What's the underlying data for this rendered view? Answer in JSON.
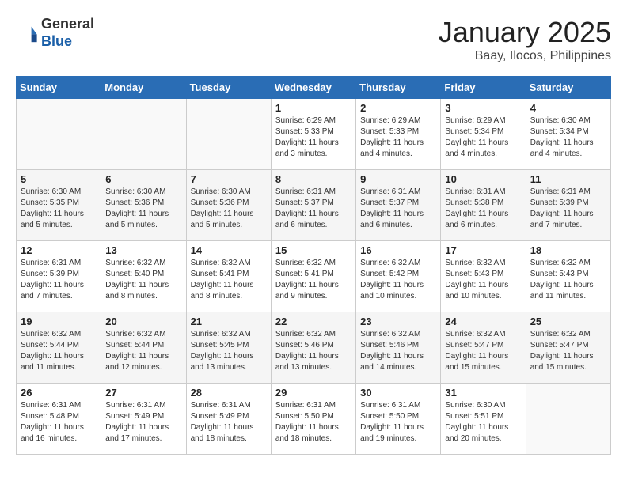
{
  "header": {
    "logo_line1": "General",
    "logo_line2": "Blue",
    "title": "January 2025",
    "subtitle": "Baay, Ilocos, Philippines"
  },
  "weekdays": [
    "Sunday",
    "Monday",
    "Tuesday",
    "Wednesday",
    "Thursday",
    "Friday",
    "Saturday"
  ],
  "weeks": [
    [
      {
        "day": "",
        "sunrise": "",
        "sunset": "",
        "daylight": ""
      },
      {
        "day": "",
        "sunrise": "",
        "sunset": "",
        "daylight": ""
      },
      {
        "day": "",
        "sunrise": "",
        "sunset": "",
        "daylight": ""
      },
      {
        "day": "1",
        "sunrise": "Sunrise: 6:29 AM",
        "sunset": "Sunset: 5:33 PM",
        "daylight": "Daylight: 11 hours and 3 minutes."
      },
      {
        "day": "2",
        "sunrise": "Sunrise: 6:29 AM",
        "sunset": "Sunset: 5:33 PM",
        "daylight": "Daylight: 11 hours and 4 minutes."
      },
      {
        "day": "3",
        "sunrise": "Sunrise: 6:29 AM",
        "sunset": "Sunset: 5:34 PM",
        "daylight": "Daylight: 11 hours and 4 minutes."
      },
      {
        "day": "4",
        "sunrise": "Sunrise: 6:30 AM",
        "sunset": "Sunset: 5:34 PM",
        "daylight": "Daylight: 11 hours and 4 minutes."
      }
    ],
    [
      {
        "day": "5",
        "sunrise": "Sunrise: 6:30 AM",
        "sunset": "Sunset: 5:35 PM",
        "daylight": "Daylight: 11 hours and 5 minutes."
      },
      {
        "day": "6",
        "sunrise": "Sunrise: 6:30 AM",
        "sunset": "Sunset: 5:36 PM",
        "daylight": "Daylight: 11 hours and 5 minutes."
      },
      {
        "day": "7",
        "sunrise": "Sunrise: 6:30 AM",
        "sunset": "Sunset: 5:36 PM",
        "daylight": "Daylight: 11 hours and 5 minutes."
      },
      {
        "day": "8",
        "sunrise": "Sunrise: 6:31 AM",
        "sunset": "Sunset: 5:37 PM",
        "daylight": "Daylight: 11 hours and 6 minutes."
      },
      {
        "day": "9",
        "sunrise": "Sunrise: 6:31 AM",
        "sunset": "Sunset: 5:37 PM",
        "daylight": "Daylight: 11 hours and 6 minutes."
      },
      {
        "day": "10",
        "sunrise": "Sunrise: 6:31 AM",
        "sunset": "Sunset: 5:38 PM",
        "daylight": "Daylight: 11 hours and 6 minutes."
      },
      {
        "day": "11",
        "sunrise": "Sunrise: 6:31 AM",
        "sunset": "Sunset: 5:39 PM",
        "daylight": "Daylight: 11 hours and 7 minutes."
      }
    ],
    [
      {
        "day": "12",
        "sunrise": "Sunrise: 6:31 AM",
        "sunset": "Sunset: 5:39 PM",
        "daylight": "Daylight: 11 hours and 7 minutes."
      },
      {
        "day": "13",
        "sunrise": "Sunrise: 6:32 AM",
        "sunset": "Sunset: 5:40 PM",
        "daylight": "Daylight: 11 hours and 8 minutes."
      },
      {
        "day": "14",
        "sunrise": "Sunrise: 6:32 AM",
        "sunset": "Sunset: 5:41 PM",
        "daylight": "Daylight: 11 hours and 8 minutes."
      },
      {
        "day": "15",
        "sunrise": "Sunrise: 6:32 AM",
        "sunset": "Sunset: 5:41 PM",
        "daylight": "Daylight: 11 hours and 9 minutes."
      },
      {
        "day": "16",
        "sunrise": "Sunrise: 6:32 AM",
        "sunset": "Sunset: 5:42 PM",
        "daylight": "Daylight: 11 hours and 10 minutes."
      },
      {
        "day": "17",
        "sunrise": "Sunrise: 6:32 AM",
        "sunset": "Sunset: 5:43 PM",
        "daylight": "Daylight: 11 hours and 10 minutes."
      },
      {
        "day": "18",
        "sunrise": "Sunrise: 6:32 AM",
        "sunset": "Sunset: 5:43 PM",
        "daylight": "Daylight: 11 hours and 11 minutes."
      }
    ],
    [
      {
        "day": "19",
        "sunrise": "Sunrise: 6:32 AM",
        "sunset": "Sunset: 5:44 PM",
        "daylight": "Daylight: 11 hours and 11 minutes."
      },
      {
        "day": "20",
        "sunrise": "Sunrise: 6:32 AM",
        "sunset": "Sunset: 5:44 PM",
        "daylight": "Daylight: 11 hours and 12 minutes."
      },
      {
        "day": "21",
        "sunrise": "Sunrise: 6:32 AM",
        "sunset": "Sunset: 5:45 PM",
        "daylight": "Daylight: 11 hours and 13 minutes."
      },
      {
        "day": "22",
        "sunrise": "Sunrise: 6:32 AM",
        "sunset": "Sunset: 5:46 PM",
        "daylight": "Daylight: 11 hours and 13 minutes."
      },
      {
        "day": "23",
        "sunrise": "Sunrise: 6:32 AM",
        "sunset": "Sunset: 5:46 PM",
        "daylight": "Daylight: 11 hours and 14 minutes."
      },
      {
        "day": "24",
        "sunrise": "Sunrise: 6:32 AM",
        "sunset": "Sunset: 5:47 PM",
        "daylight": "Daylight: 11 hours and 15 minutes."
      },
      {
        "day": "25",
        "sunrise": "Sunrise: 6:32 AM",
        "sunset": "Sunset: 5:47 PM",
        "daylight": "Daylight: 11 hours and 15 minutes."
      }
    ],
    [
      {
        "day": "26",
        "sunrise": "Sunrise: 6:31 AM",
        "sunset": "Sunset: 5:48 PM",
        "daylight": "Daylight: 11 hours and 16 minutes."
      },
      {
        "day": "27",
        "sunrise": "Sunrise: 6:31 AM",
        "sunset": "Sunset: 5:49 PM",
        "daylight": "Daylight: 11 hours and 17 minutes."
      },
      {
        "day": "28",
        "sunrise": "Sunrise: 6:31 AM",
        "sunset": "Sunset: 5:49 PM",
        "daylight": "Daylight: 11 hours and 18 minutes."
      },
      {
        "day": "29",
        "sunrise": "Sunrise: 6:31 AM",
        "sunset": "Sunset: 5:50 PM",
        "daylight": "Daylight: 11 hours and 18 minutes."
      },
      {
        "day": "30",
        "sunrise": "Sunrise: 6:31 AM",
        "sunset": "Sunset: 5:50 PM",
        "daylight": "Daylight: 11 hours and 19 minutes."
      },
      {
        "day": "31",
        "sunrise": "Sunrise: 6:30 AM",
        "sunset": "Sunset: 5:51 PM",
        "daylight": "Daylight: 11 hours and 20 minutes."
      },
      {
        "day": "",
        "sunrise": "",
        "sunset": "",
        "daylight": ""
      }
    ]
  ]
}
